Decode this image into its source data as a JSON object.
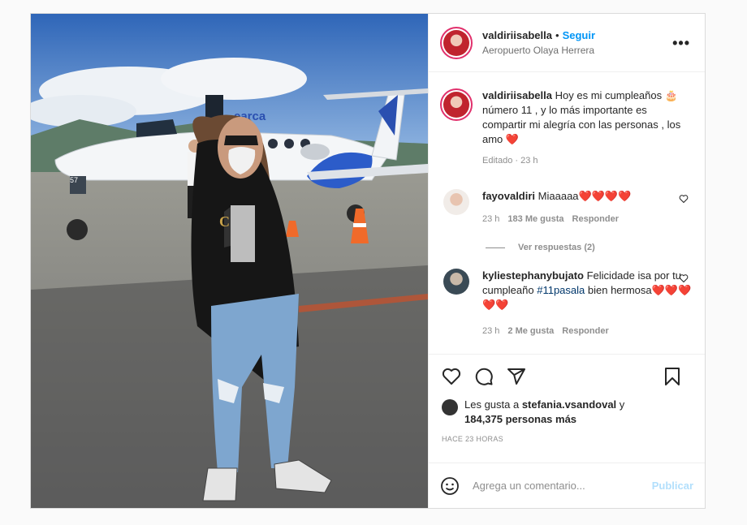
{
  "header": {
    "username": "valdiriisabella",
    "separator": "•",
    "follow_label": "Seguir",
    "location": "Aeropuerto Olaya Herrera",
    "more": "•••"
  },
  "photo": {
    "airline_logo": "earca",
    "tail_number": "57"
  },
  "caption": {
    "username": "valdiriisabella",
    "text": "Hoy es mi cumpleaños 🎂 número 11 , y lo más importante es compartir mi alegría con las personas , los amo ❤️",
    "edited": "Editado · 23 h"
  },
  "comments": [
    {
      "username": "fayovaldiri",
      "text": "Miaaaaa❤️❤️❤️❤️",
      "time": "23 h",
      "likes": "183 Me gusta",
      "reply": "Responder",
      "view_replies": "Ver respuestas (2)"
    },
    {
      "username": "kyliestephanybujato",
      "text_before": "Felicidade isa por tu cumpleaño ",
      "hashtag": "#11pasala",
      "text_after": " bien hermosa❤️❤️❤️❤️❤️",
      "time": "23 h",
      "likes": "2 Me gusta",
      "reply": "Responder"
    }
  ],
  "likes": {
    "prefix": "Les gusta a ",
    "user": "stefania.vsandoval",
    "middle": " y ",
    "count": "184,375 personas más"
  },
  "timestamp": "HACE 23 HORAS",
  "comment_box": {
    "placeholder": "Agrega un comentario...",
    "publish": "Publicar"
  },
  "colors": {
    "accent": "#0095f6",
    "publish_disabled": "#b2dffc",
    "heart": "#ed4956"
  }
}
